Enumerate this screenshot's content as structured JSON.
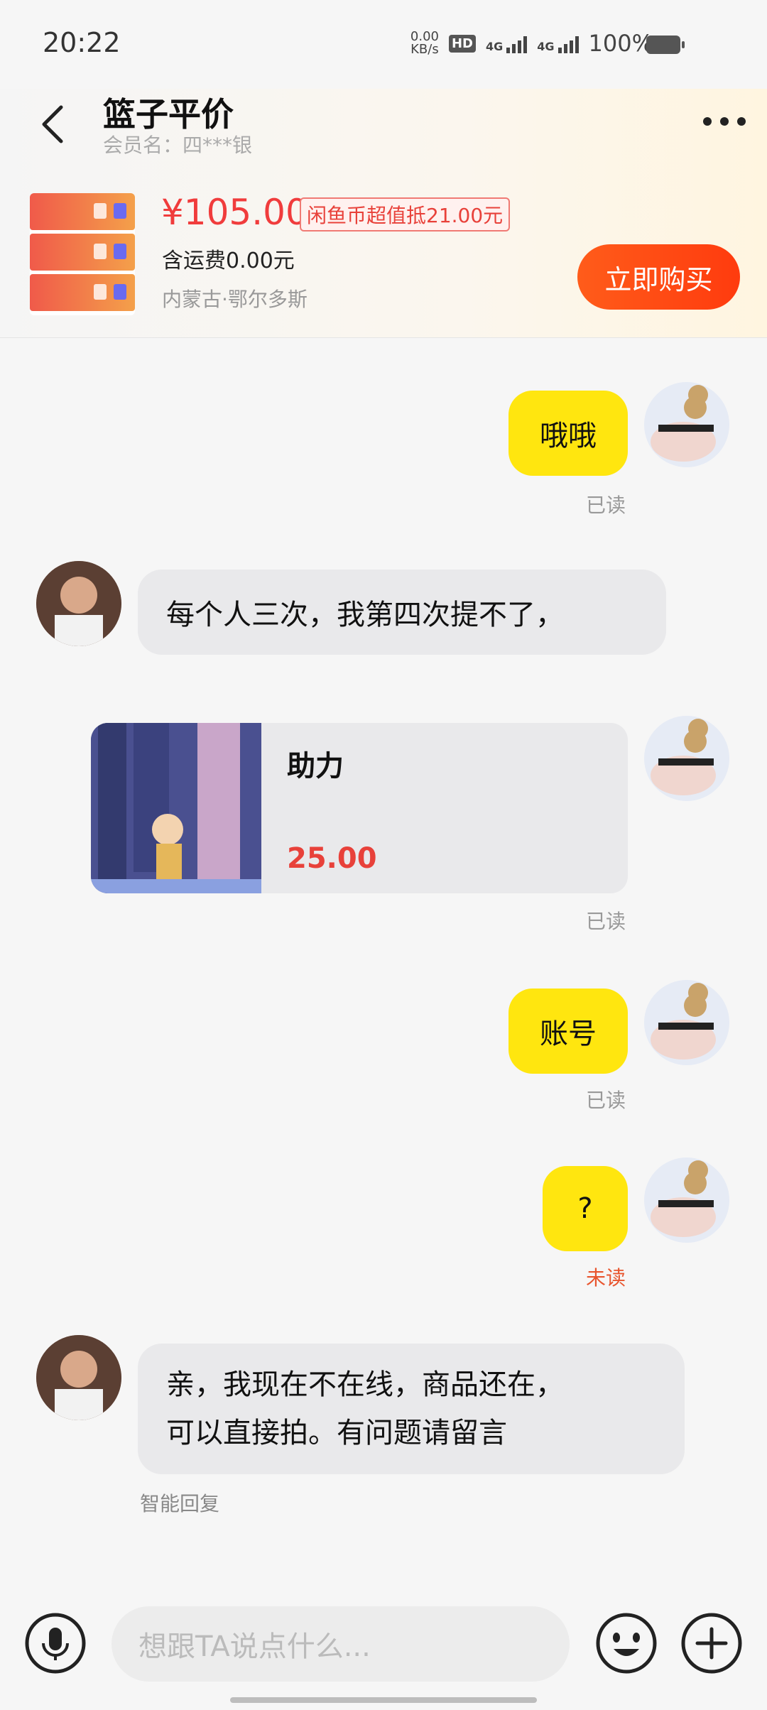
{
  "status": {
    "time": "20:22",
    "speed": "0.00",
    "speed_unit": "KB/s",
    "hd": "HD",
    "net1": "4G",
    "net2": "4G",
    "battery": "100%"
  },
  "header": {
    "title": "篮子平价",
    "member": "会员名：四***银"
  },
  "product": {
    "price": "¥105.00",
    "coupon": "闲鱼币超值抵21.00元",
    "shipping": "含运费0.00元",
    "location": "内蒙古·鄂尔多斯",
    "buy_label": "立即购买"
  },
  "messages": {
    "m1_text": "哦哦",
    "m1_status": "已读",
    "m2_text": "每个人三次，我第四次提不了，",
    "card_title": "助力",
    "card_price": "25.00",
    "card_status": "已读",
    "m4_text": "账号",
    "m4_status": "已读",
    "m5_text": "?",
    "m5_status": "未读",
    "m6_line1": "亲，我现在不在线，商品还在，",
    "m6_line2": "可以直接拍。有问题请留言",
    "smart_reply": "智能回复"
  },
  "input": {
    "placeholder": "想跟TA说点什么..."
  }
}
